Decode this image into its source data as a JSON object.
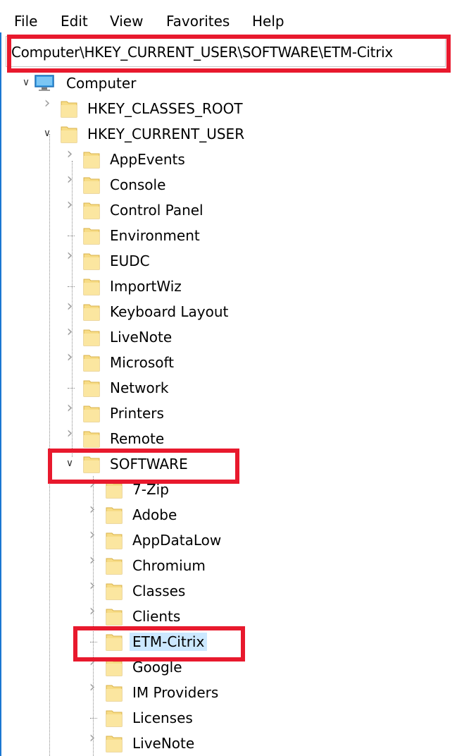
{
  "menu": {
    "file": "File",
    "edit": "Edit",
    "view": "View",
    "favorites": "Favorites",
    "help": "Help"
  },
  "address": {
    "path": "Computer\\HKEY_CURRENT_USER\\SOFTWARE\\ETM-Citrix"
  },
  "colors": {
    "highlight": "#e8192d",
    "selection": "#cce8ff",
    "folder": "#f5d77a",
    "window_border": "#1b77d1"
  },
  "tree": {
    "computer": "Computer",
    "hkcr": "HKEY_CLASSES_ROOT",
    "hkcu": "HKEY_CURRENT_USER",
    "hkcu_children": [
      "AppEvents",
      "Console",
      "Control Panel",
      "Environment",
      "EUDC",
      "ImportWiz",
      "Keyboard Layout",
      "LiveNote",
      "Microsoft",
      "Network",
      "Printers",
      "Remote"
    ],
    "software": "SOFTWARE",
    "software_children": [
      "7-Zip",
      "Adobe",
      "AppDataLow",
      "Chromium",
      "Classes",
      "Clients",
      "ETM-Citrix",
      "Google",
      "IM Providers",
      "Licenses",
      "LiveNote"
    ]
  }
}
